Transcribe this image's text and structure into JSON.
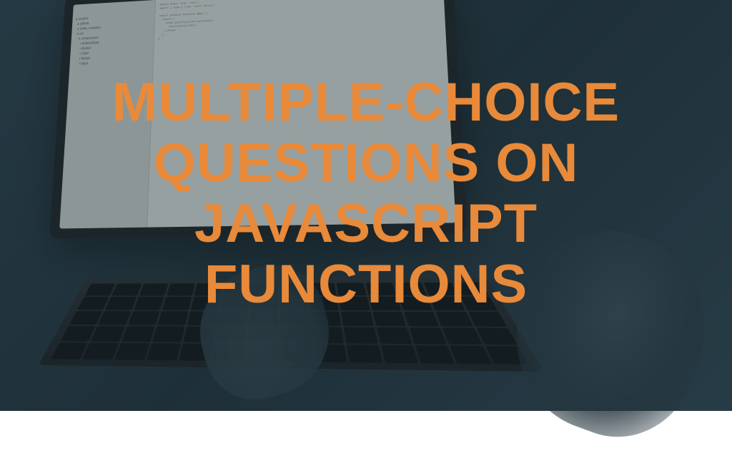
{
  "headline": {
    "line1": "MULTIPLE-CHOICE",
    "line2": "QUESTIONS ON",
    "line3": "JAVASCRIPT",
    "line4": "FUNCTIONS"
  },
  "colors": {
    "headline": "#e88a3a",
    "overlay": "rgba(30, 50, 60, 0.45)"
  }
}
